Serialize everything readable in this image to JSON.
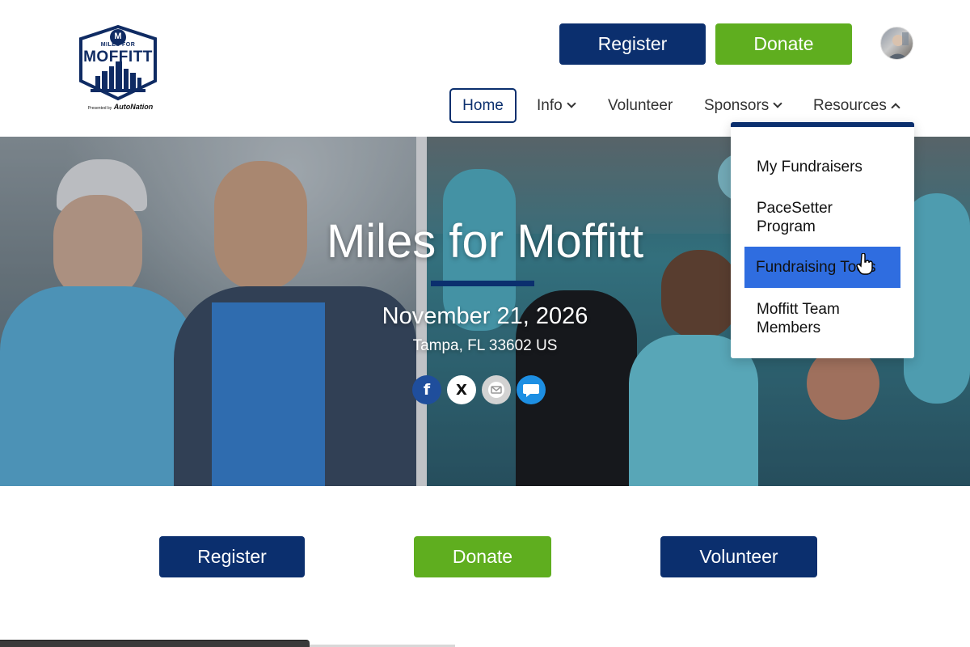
{
  "logo": {
    "small": "MILES FOR",
    "big": "MOFFITT",
    "presented_by": "Presented by",
    "sponsor": "AutoNation",
    "emblem_letter": "M"
  },
  "header": {
    "register_label": "Register",
    "donate_label": "Donate"
  },
  "nav": {
    "home": "Home",
    "info": "Info",
    "volunteer": "Volunteer",
    "sponsors": "Sponsors",
    "resources": "Resources"
  },
  "dropdown": {
    "items": [
      "My Fundraisers",
      "PaceSetter Program",
      "Fundraising Tools",
      "Moffitt Team Members"
    ],
    "highlighted_index": 2
  },
  "hero": {
    "title": "Miles for Moffitt",
    "date": "November 21, 2026",
    "location": "Tampa, FL 33602 US"
  },
  "share": {
    "facebook": "f",
    "x": "X",
    "icons": [
      "facebook-icon",
      "x-icon",
      "email-icon",
      "sms-icon"
    ]
  },
  "cta": {
    "register": "Register",
    "donate": "Donate",
    "volunteer": "Volunteer"
  },
  "colors": {
    "navy": "#0b2f6e",
    "green": "#5fae1f",
    "highlight": "#2f6de0"
  }
}
